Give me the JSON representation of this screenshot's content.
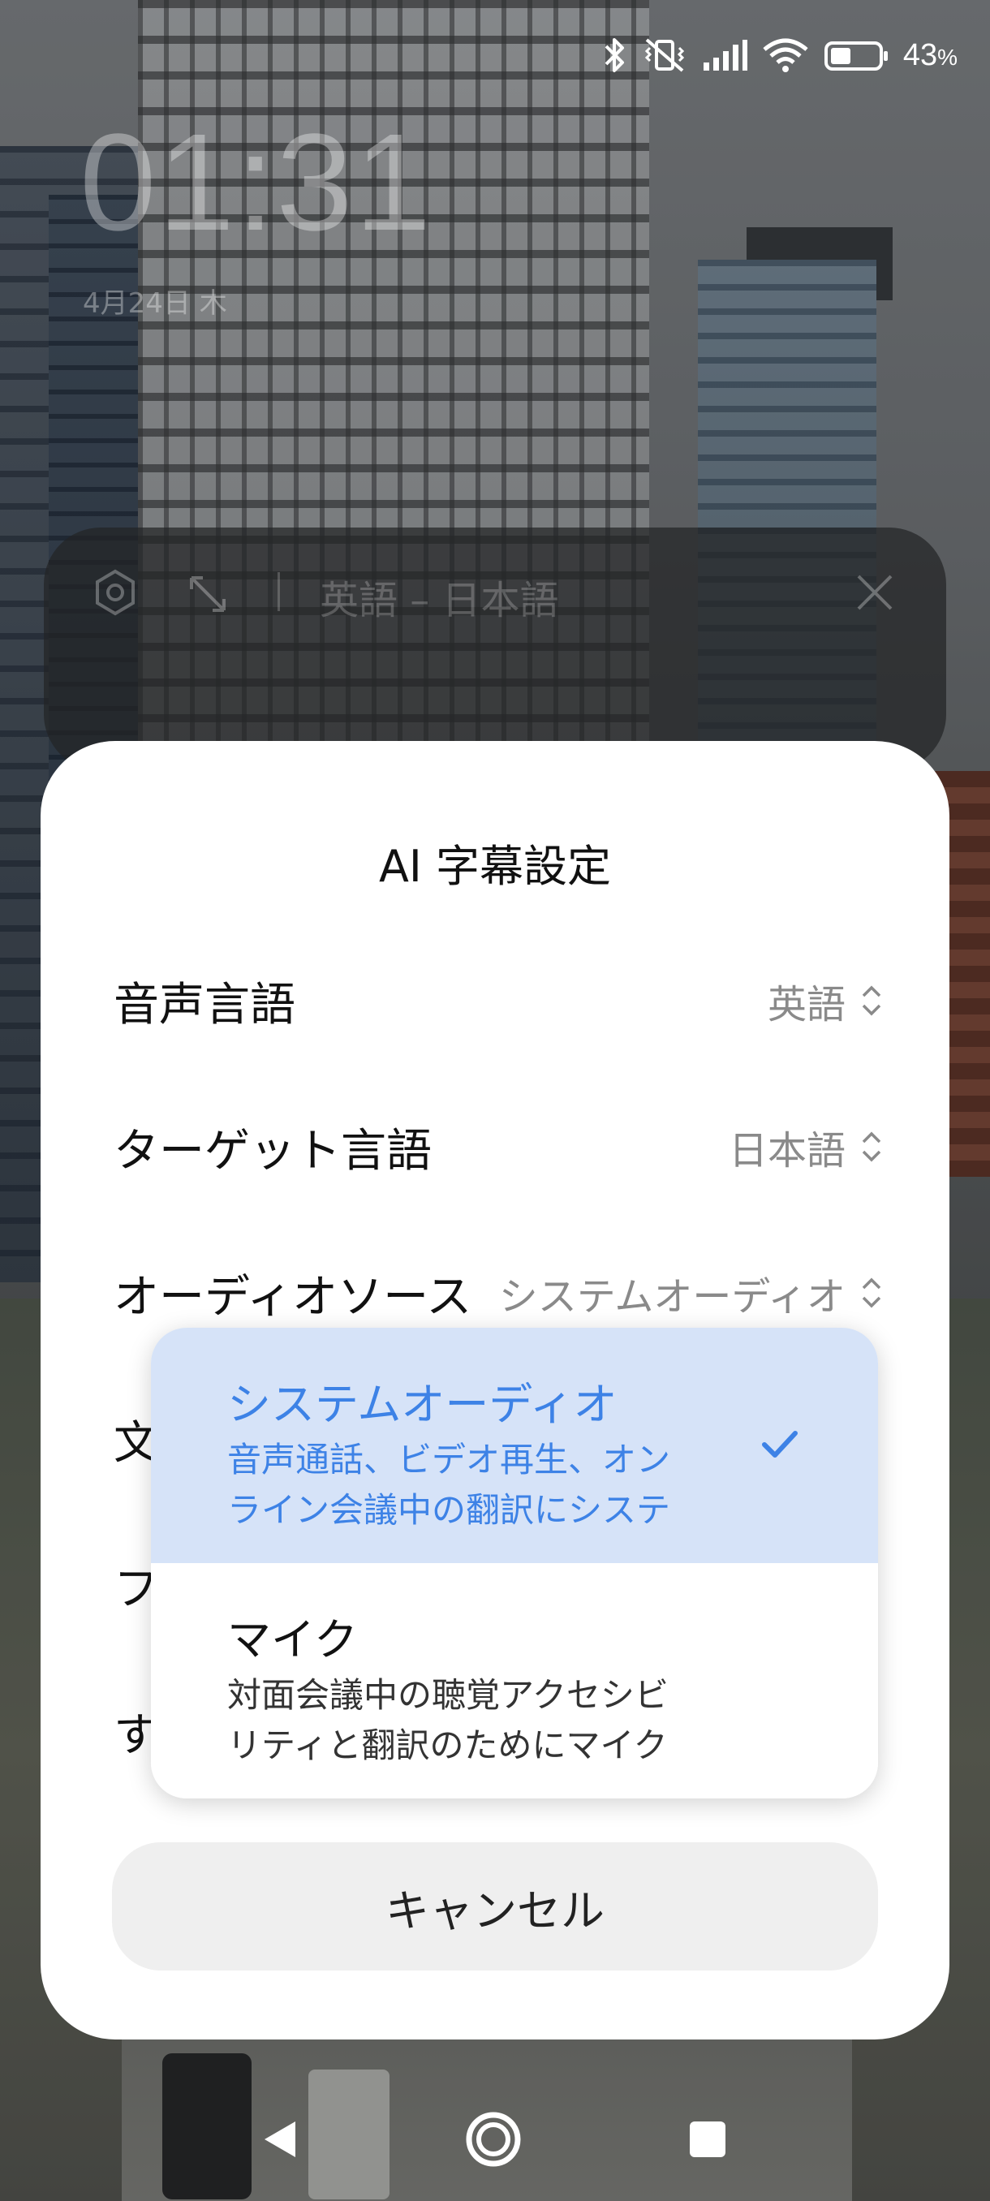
{
  "status_bar": {
    "battery_percent": "43",
    "battery_suffix": "%",
    "battery_level": 0.43,
    "icons": [
      "bluetooth-icon",
      "vibrate-off-icon",
      "signal-icon",
      "wifi-icon",
      "battery-icon"
    ]
  },
  "lockscreen": {
    "time": "01:31",
    "date": "4月24日 木"
  },
  "caption_bar": {
    "language_pair": "英語 – 日本語",
    "icons": [
      "settings-hex-icon",
      "expand-icon",
      "close-icon"
    ]
  },
  "sheet": {
    "title": "AI 字幕設定",
    "rows": [
      {
        "label": "音声言語",
        "value": "英語"
      },
      {
        "label": "ターゲット言語",
        "value": "日本語"
      },
      {
        "label": "オーディオソース",
        "value": "システムオーディオ"
      },
      {
        "label": "文",
        "value": ""
      },
      {
        "label": "フ",
        "value": ""
      },
      {
        "label": "す",
        "value": ""
      }
    ],
    "cancel_label": "キャンセル"
  },
  "dropdown": {
    "options": [
      {
        "title": "システムオーディオ",
        "desc_line1": "音声通話、ビデオ再生、オン",
        "desc_line2": "ライン会議中の翻訳にシステ",
        "selected": true
      },
      {
        "title": "マイク",
        "desc_line1": "対面会議中の聴覚アクセシビ",
        "desc_line2": "リティと翻訳のためにマイク",
        "selected": false
      }
    ]
  },
  "colors": {
    "accent": "#3d82e6",
    "selected_bg": "#d6e3f8",
    "sheet_bg": "#ffffff",
    "cancel_bg": "#efefef"
  },
  "navbar": {
    "icons": [
      "back-icon",
      "home-icon",
      "recents-icon"
    ]
  }
}
